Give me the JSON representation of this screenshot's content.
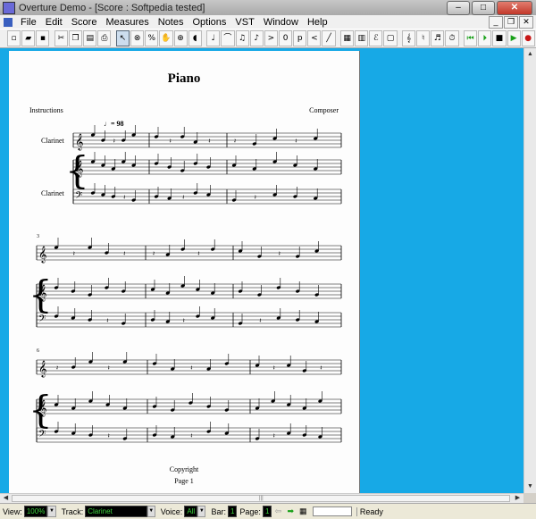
{
  "window": {
    "title": "Overture Demo - [Score : Softpedia tested]",
    "buttons": {
      "minimize": "–",
      "maximize": "□",
      "close": "✕"
    }
  },
  "menubar": {
    "items": [
      "File",
      "Edit",
      "Score",
      "Measures",
      "Notes",
      "Options",
      "VST",
      "Window",
      "Help"
    ],
    "mdi_buttons": {
      "minimize": "_",
      "restore": "❐",
      "close": "✕"
    }
  },
  "toolbar": {
    "groups": [
      [
        {
          "name": "new-icon",
          "glyph": "▫"
        },
        {
          "name": "open-folder-icon",
          "glyph": "▰"
        },
        {
          "name": "save-icon",
          "glyph": "▪"
        }
      ],
      [
        {
          "name": "cut-icon",
          "glyph": "✂"
        },
        {
          "name": "copy-icon",
          "glyph": "❐"
        },
        {
          "name": "paste-icon",
          "glyph": "▤"
        },
        {
          "name": "print-icon",
          "glyph": "⎙"
        }
      ],
      [
        {
          "name": "select-arrow-icon",
          "glyph": "↖",
          "selected": true
        },
        {
          "name": "erase-icon",
          "glyph": "⊗"
        },
        {
          "name": "percent-icon",
          "glyph": "%"
        },
        {
          "name": "hand-icon",
          "glyph": "✋"
        },
        {
          "name": "zoom-icon",
          "glyph": "⊕"
        },
        {
          "name": "audio-icon",
          "glyph": "◖"
        }
      ],
      [
        {
          "name": "quarter-note-icon",
          "glyph": "♩"
        },
        {
          "name": "tie-icon",
          "glyph": "⌒"
        },
        {
          "name": "beam-icon",
          "glyph": "♫"
        },
        {
          "name": "grace-note-icon",
          "glyph": "♪"
        },
        {
          "name": "accent-icon",
          "glyph": ">"
        },
        {
          "name": "number-icon",
          "glyph": "0"
        },
        {
          "name": "dynamics-icon",
          "glyph": "p"
        },
        {
          "name": "hairpin-icon",
          "glyph": "<"
        },
        {
          "name": "line-icon",
          "glyph": "╱"
        }
      ],
      [
        {
          "name": "chord-grid-icon",
          "glyph": "▦"
        },
        {
          "name": "keyboard-icon",
          "glyph": "▥"
        },
        {
          "name": "expression-icon",
          "glyph": "ℰ"
        },
        {
          "name": "box-icon",
          "glyph": "▢"
        }
      ],
      [
        {
          "name": "treble-clef-icon",
          "glyph": "𝄞"
        },
        {
          "name": "staff-icon",
          "glyph": "♮"
        },
        {
          "name": "rest-icon",
          "glyph": "♬"
        },
        {
          "name": "metronome-icon",
          "glyph": "⏱"
        }
      ],
      [
        {
          "name": "rewind-icon",
          "glyph": "⏮",
          "color": "green"
        },
        {
          "name": "step-play-icon",
          "glyph": "⏵",
          "color": "green"
        },
        {
          "name": "stop-icon",
          "glyph": "■"
        },
        {
          "name": "play-icon",
          "glyph": "▶",
          "color": "green"
        },
        {
          "name": "record-icon",
          "glyph": "●",
          "color": "red"
        }
      ]
    ]
  },
  "score": {
    "title": "Piano",
    "instructions": "Instructions",
    "composer": "Composer",
    "tempo": "♩= 98",
    "staff_label_1": "Clarinet",
    "staff_label_2": "Clarinet",
    "measure_number_system2": "3",
    "measure_number_system3": "6",
    "copyright": "Copyright",
    "page_label": "Page 1"
  },
  "statusbar": {
    "view_label": "View:",
    "view_value": "100%",
    "track_label": "Track:",
    "track_value": "Clarinet",
    "voice_label": "Voice:",
    "voice_value": "All",
    "bar_label": "Bar:",
    "bar_value": "1",
    "page_label": "Page:",
    "page_value": "1",
    "status_text": "Ready"
  }
}
